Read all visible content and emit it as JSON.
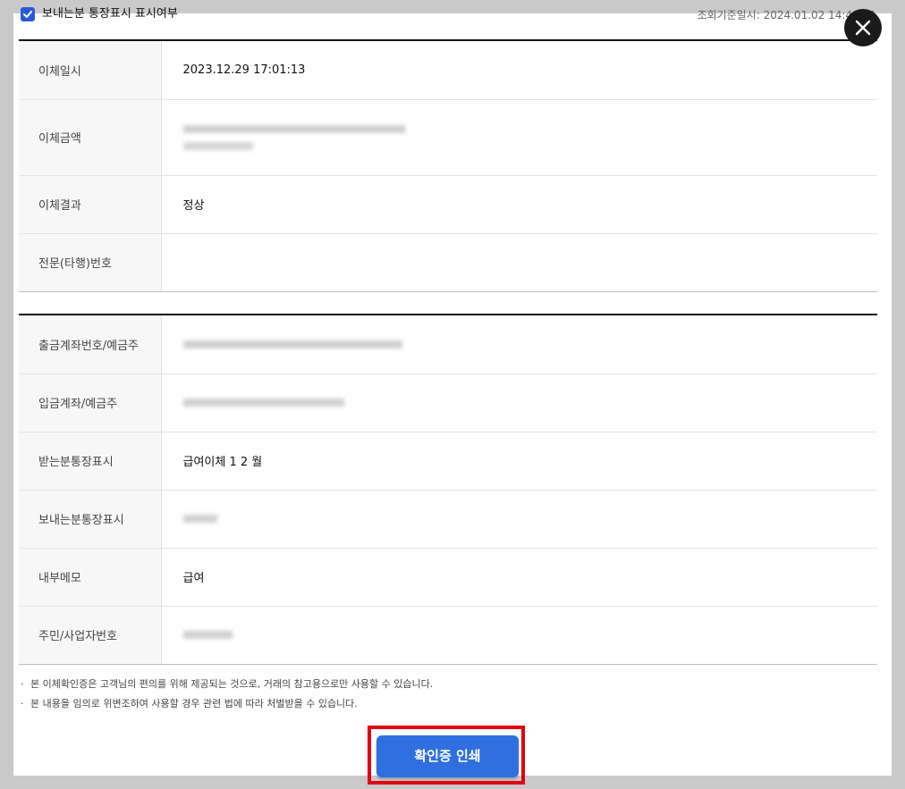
{
  "header": {
    "checkbox_label": "보내는분 통장표시 표시여부",
    "checkbox_checked": true,
    "query_time": "조회기준일시: 2024.01.02 14:48:31"
  },
  "close_button": {
    "icon": "close-icon"
  },
  "section1": [
    {
      "label": "이체일시",
      "value": "2023.12.29 17:01:13"
    },
    {
      "label": "이체금액",
      "value": "",
      "value_line2": ""
    },
    {
      "label": "이체결과",
      "value": "정상"
    },
    {
      "label": "전문(타행)번호",
      "value": ""
    }
  ],
  "section2": [
    {
      "label": "출금계좌번호/예금주",
      "value": ""
    },
    {
      "label": "입금계좌/예금주",
      "value": ""
    },
    {
      "label": "받는분통장표시",
      "value": "급여이체 1 2 월"
    },
    {
      "label": "보내는분통장표시",
      "value": ""
    },
    {
      "label": "내부메모",
      "value": "급여"
    },
    {
      "label": "주민/사업자번호",
      "value": ""
    }
  ],
  "notes": [
    "본 이체확인증은 고객님의 편의를 위해 제공되는 것으로, 거래의 참고용으로만 사용할 수 있습니다.",
    "본 내용을 임의로 위변조하여 사용할 경우 관련 법에 따라 처벌받을 수 있습니다."
  ],
  "print_button": {
    "label": "확인증 인쇄"
  },
  "colors": {
    "accent": "#2f6fe0",
    "highlight": "#e00010",
    "close": "#1a1a1a"
  }
}
